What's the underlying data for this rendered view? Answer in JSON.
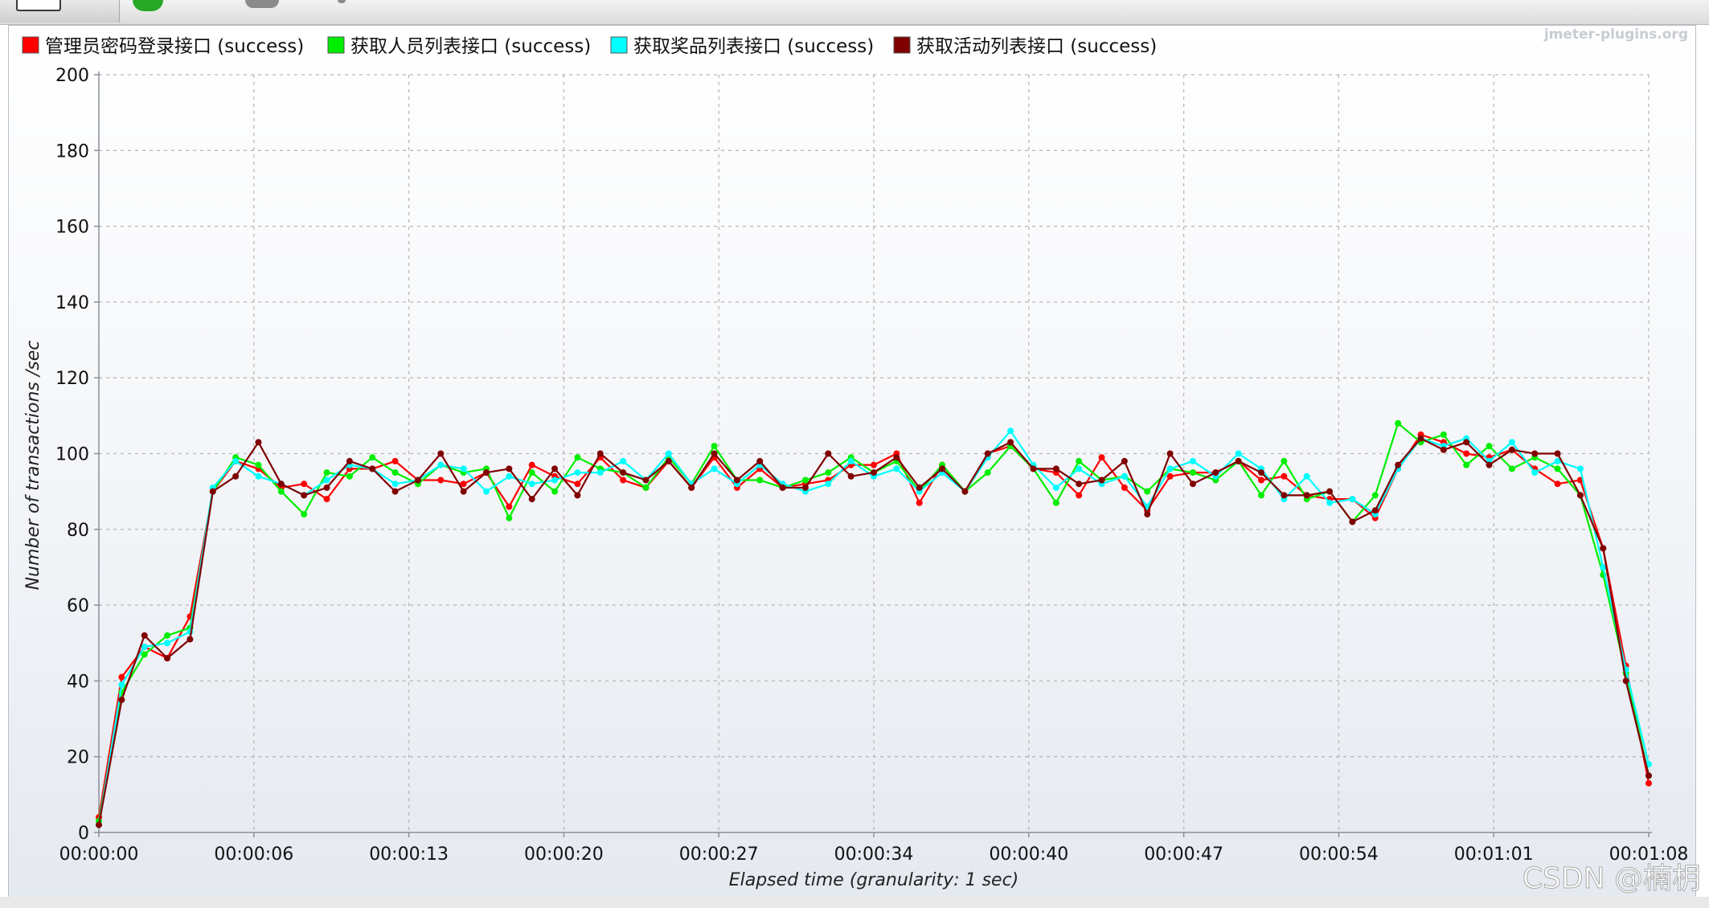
{
  "watermark": "jmeter-plugins.org",
  "footer_watermark": "CSDN @楠枂",
  "chart_data": {
    "type": "line",
    "title": "",
    "xlabel": "Elapsed time (granularity: 1 sec)",
    "ylabel": "Number of transactions /sec",
    "ylim": [
      0,
      200
    ],
    "yticks": [
      0,
      20,
      40,
      60,
      80,
      100,
      120,
      140,
      160,
      180,
      200
    ],
    "xlim": [
      0,
      68
    ],
    "xtick_values": [
      0,
      6.8,
      13.6,
      20.4,
      27.2,
      34,
      40.8,
      47.6,
      54.4,
      61.2,
      68
    ],
    "xtick_labels": [
      "00:00:00",
      "00:00:06",
      "00:00:13",
      "00:00:20",
      "00:00:27",
      "00:00:34",
      "00:00:40",
      "00:00:47",
      "00:00:54",
      "00:01:01",
      "00:01:08"
    ],
    "grid": true,
    "legend_position": "top-left",
    "x": [
      0,
      1,
      2,
      3,
      4,
      5,
      6,
      7,
      8,
      9,
      10,
      11,
      12,
      13,
      14,
      15,
      16,
      17,
      18,
      19,
      20,
      21,
      22,
      23,
      24,
      25,
      26,
      27,
      28,
      29,
      30,
      31,
      32,
      33,
      34,
      35,
      36,
      37,
      38,
      39,
      40,
      41,
      42,
      43,
      44,
      45,
      46,
      47,
      48,
      49,
      50,
      51,
      52,
      53,
      54,
      55,
      56,
      57,
      58,
      59,
      60,
      61,
      62,
      63,
      64,
      65,
      66,
      67,
      68
    ],
    "series": [
      {
        "name": "管理员密码登录接口 (success)",
        "color": "#ff0000",
        "values": [
          4,
          41,
          49,
          46,
          57,
          90,
          98,
          96,
          91,
          92,
          88,
          96,
          96,
          98,
          93,
          93,
          92,
          95,
          86,
          97,
          94,
          92,
          99,
          93,
          91,
          98,
          91,
          99,
          91,
          96,
          91,
          92,
          93,
          97,
          97,
          100,
          87,
          97,
          90,
          100,
          102,
          96,
          95,
          89,
          99,
          91,
          85,
          94,
          95,
          95,
          98,
          93,
          94,
          89,
          88,
          88,
          83,
          96,
          105,
          103,
          100,
          99,
          101,
          96,
          92,
          93,
          75,
          44,
          13
        ]
      },
      {
        "name": "获取人员列表接口 (success)",
        "color": "#00ee00",
        "values": [
          3,
          37,
          47,
          52,
          54,
          90,
          99,
          97,
          90,
          84,
          95,
          94,
          99,
          95,
          92,
          97,
          95,
          96,
          83,
          95,
          90,
          99,
          96,
          95,
          91,
          99,
          92,
          102,
          93,
          93,
          91,
          93,
          95,
          99,
          95,
          98,
          90,
          97,
          90,
          95,
          102,
          96,
          87,
          98,
          93,
          94,
          90,
          96,
          95,
          93,
          98,
          89,
          98,
          88,
          90,
          82,
          89,
          108,
          103,
          105,
          97,
          102,
          96,
          99,
          96,
          89,
          68,
          42,
          15
        ]
      },
      {
        "name": "获取奖品列表接口 (success)",
        "color": "#00ffff",
        "values": [
          2,
          39,
          49,
          50,
          53,
          91,
          98,
          94,
          92,
          89,
          93,
          97,
          96,
          92,
          93,
          97,
          96,
          90,
          94,
          92,
          93,
          95,
          95,
          98,
          93,
          100,
          92,
          96,
          92,
          97,
          92,
          90,
          92,
          98,
          94,
          96,
          90,
          95,
          90,
          99,
          106,
          97,
          91,
          96,
          92,
          94,
          86,
          96,
          98,
          94,
          100,
          96,
          88,
          94,
          87,
          88,
          84,
          96,
          104,
          102,
          104,
          98,
          103,
          95,
          98,
          96,
          70,
          43,
          18
        ]
      },
      {
        "name": "获取活动列表接口 (success)",
        "color": "#800000",
        "values": [
          2,
          35,
          52,
          46,
          51,
          90,
          94,
          103,
          92,
          89,
          91,
          98,
          96,
          90,
          93,
          100,
          90,
          95,
          96,
          88,
          96,
          89,
          100,
          95,
          93,
          98,
          91,
          100,
          93,
          98,
          91,
          91,
          100,
          94,
          95,
          99,
          91,
          96,
          90,
          100,
          103,
          96,
          96,
          92,
          93,
          98,
          84,
          100,
          92,
          95,
          98,
          95,
          89,
          89,
          90,
          82,
          85,
          97,
          104,
          101,
          103,
          97,
          101,
          100,
          100,
          89,
          75,
          40,
          15
        ]
      }
    ]
  }
}
